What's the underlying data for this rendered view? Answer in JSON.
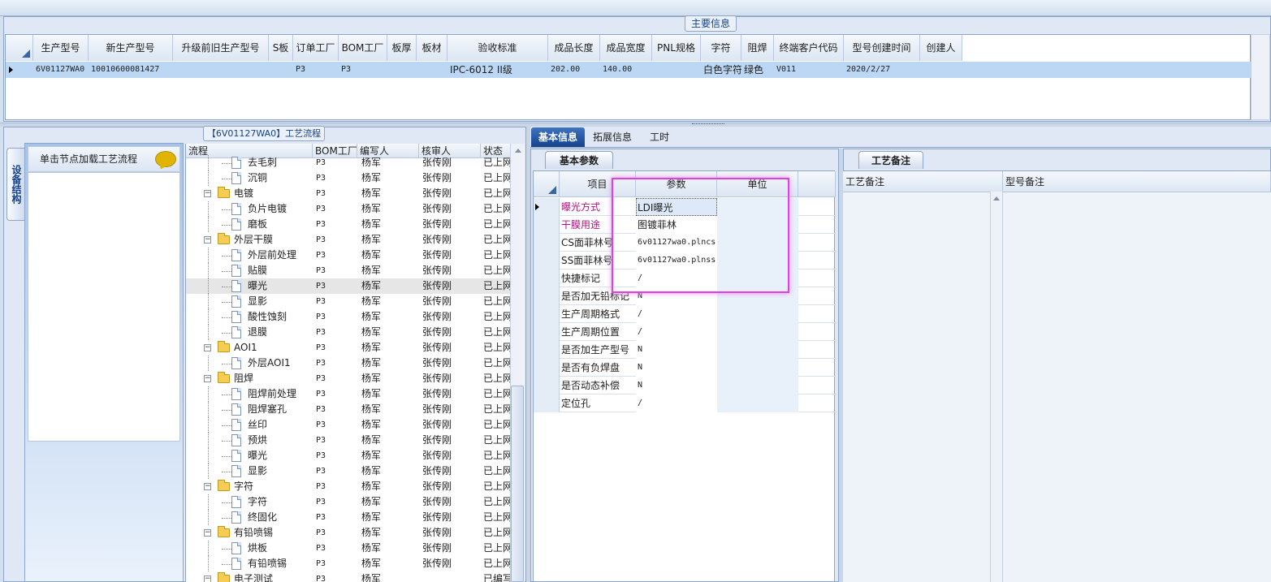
{
  "main_info": {
    "title": "主要信息",
    "columns": [
      "生产型号",
      "新生产型号",
      "升级前旧生产型号",
      "S板",
      "订单工厂",
      "BOM工厂",
      "板厚",
      "板材",
      "验收标准",
      "成品长度",
      "成品宽度",
      "PNL规格",
      "字符",
      "阻焊",
      "终端客户代码",
      "型号创建时间",
      "创建人"
    ],
    "row": [
      "6V01127WA0",
      "10010600081427",
      "",
      "",
      "P3",
      "P3",
      "",
      "",
      "IPC-6012 II级",
      "202.00",
      "140.00",
      "",
      "白色字符",
      "绿色",
      "V011",
      "2020/2/27",
      ""
    ]
  },
  "left_panel": {
    "title": "【6V01127WA0】工艺流程",
    "vertical_tab": "设备结构",
    "side_header": "单击节点加载工艺流程",
    "tree_columns": [
      "流程",
      "BOM工厂",
      "编写人",
      "核审人",
      "状态"
    ],
    "rows": [
      {
        "label": "去毛刺",
        "type": "doc",
        "bom": "P3",
        "writer": "杨军",
        "reviewer": "张传刚",
        "status": "已上网"
      },
      {
        "label": "沉铜",
        "type": "doc",
        "bom": "P3",
        "writer": "杨军",
        "reviewer": "张传刚",
        "status": "已上网"
      },
      {
        "label": "电镀",
        "type": "folder",
        "bom": "P3",
        "writer": "杨军",
        "reviewer": "张传刚",
        "status": "已上网"
      },
      {
        "label": "负片电镀",
        "type": "doc",
        "bom": "P3",
        "writer": "杨军",
        "reviewer": "张传刚",
        "status": "已上网"
      },
      {
        "label": "磨板",
        "type": "doc",
        "bom": "P3",
        "writer": "杨军",
        "reviewer": "张传刚",
        "status": "已上网"
      },
      {
        "label": "外层干膜",
        "type": "folder",
        "bom": "P3",
        "writer": "杨军",
        "reviewer": "张传刚",
        "status": "已上网"
      },
      {
        "label": "外层前处理",
        "type": "doc",
        "bom": "P3",
        "writer": "杨军",
        "reviewer": "张传刚",
        "status": "已上网"
      },
      {
        "label": "贴膜",
        "type": "doc",
        "bom": "P3",
        "writer": "杨军",
        "reviewer": "张传刚",
        "status": "已上网"
      },
      {
        "label": "曝光",
        "type": "doc",
        "bom": "P3",
        "writer": "杨军",
        "reviewer": "张传刚",
        "status": "已上网",
        "selected": true
      },
      {
        "label": "显影",
        "type": "doc",
        "bom": "P3",
        "writer": "杨军",
        "reviewer": "张传刚",
        "status": "已上网"
      },
      {
        "label": "酸性蚀刻",
        "type": "doc",
        "bom": "P3",
        "writer": "杨军",
        "reviewer": "张传刚",
        "status": "已上网"
      },
      {
        "label": "退膜",
        "type": "doc",
        "bom": "P3",
        "writer": "杨军",
        "reviewer": "张传刚",
        "status": "已上网"
      },
      {
        "label": "AOI1",
        "type": "folder",
        "bom": "P3",
        "writer": "杨军",
        "reviewer": "张传刚",
        "status": "已上网"
      },
      {
        "label": "外层AOI1",
        "type": "doc",
        "bom": "P3",
        "writer": "杨军",
        "reviewer": "张传刚",
        "status": "已上网"
      },
      {
        "label": "阻焊",
        "type": "folder",
        "bom": "P3",
        "writer": "杨军",
        "reviewer": "张传刚",
        "status": "已上网"
      },
      {
        "label": "阻焊前处理",
        "type": "doc",
        "bom": "P3",
        "writer": "杨军",
        "reviewer": "张传刚",
        "status": "已上网"
      },
      {
        "label": "阻焊塞孔",
        "type": "doc",
        "bom": "P3",
        "writer": "杨军",
        "reviewer": "张传刚",
        "status": "已上网"
      },
      {
        "label": "丝印",
        "type": "doc",
        "bom": "P3",
        "writer": "杨军",
        "reviewer": "张传刚",
        "status": "已上网"
      },
      {
        "label": "预烘",
        "type": "doc",
        "bom": "P3",
        "writer": "杨军",
        "reviewer": "张传刚",
        "status": "已上网"
      },
      {
        "label": "曝光",
        "type": "doc",
        "bom": "P3",
        "writer": "杨军",
        "reviewer": "张传刚",
        "status": "已上网"
      },
      {
        "label": "显影",
        "type": "doc",
        "bom": "P3",
        "writer": "杨军",
        "reviewer": "张传刚",
        "status": "已上网"
      },
      {
        "label": "字符",
        "type": "folder",
        "bom": "P3",
        "writer": "杨军",
        "reviewer": "张传刚",
        "status": "已上网"
      },
      {
        "label": "字符",
        "type": "doc",
        "bom": "P3",
        "writer": "杨军",
        "reviewer": "张传刚",
        "status": "已上网"
      },
      {
        "label": "终固化",
        "type": "doc",
        "bom": "P3",
        "writer": "杨军",
        "reviewer": "张传刚",
        "status": "已上网"
      },
      {
        "label": "有铅喷锡",
        "type": "folder",
        "bom": "P3",
        "writer": "杨军",
        "reviewer": "张传刚",
        "status": "已上网"
      },
      {
        "label": "烘板",
        "type": "doc",
        "bom": "P3",
        "writer": "杨军",
        "reviewer": "张传刚",
        "status": "已上网"
      },
      {
        "label": "有铅喷锡",
        "type": "doc",
        "bom": "P3",
        "writer": "杨军",
        "reviewer": "张传刚",
        "status": "已上网"
      },
      {
        "label": "电子测试",
        "type": "folder",
        "bom": "P3",
        "writer": "杨军",
        "reviewer": "",
        "status": "已编写"
      }
    ]
  },
  "tabs": [
    "基本信息",
    "拓展信息",
    "工时"
  ],
  "basic": {
    "group_title": "基本参数",
    "columns": [
      "项目",
      "参数",
      "单位"
    ],
    "rows": [
      {
        "item": "曝光方式",
        "value": "LDI曝光",
        "unit": "",
        "highlight": true
      },
      {
        "item": "干膜用途",
        "value": "图镀菲林",
        "unit": "",
        "highlight": true
      },
      {
        "item": "CS面菲林号",
        "value": "6v01127wa0.plncs",
        "unit": ""
      },
      {
        "item": "SS面菲林号",
        "value": "6v01127wa0.plnss",
        "unit": ""
      },
      {
        "item": "快捷标记",
        "value": "/",
        "unit": ""
      },
      {
        "item": "是否加无铅标记",
        "value": "N",
        "unit": ""
      },
      {
        "item": "生产周期格式",
        "value": "/",
        "unit": ""
      },
      {
        "item": "生产周期位置",
        "value": "/",
        "unit": ""
      },
      {
        "item": "是否加生产型号",
        "value": "N",
        "unit": ""
      },
      {
        "item": "是否有负焊盘",
        "value": "N",
        "unit": ""
      },
      {
        "item": "是否动态补偿",
        "value": "N",
        "unit": ""
      },
      {
        "item": "定位孔",
        "value": "/",
        "unit": ""
      }
    ]
  },
  "remarks": {
    "group_title": "工艺备注",
    "columns": [
      "工艺备注",
      "型号备注"
    ]
  }
}
